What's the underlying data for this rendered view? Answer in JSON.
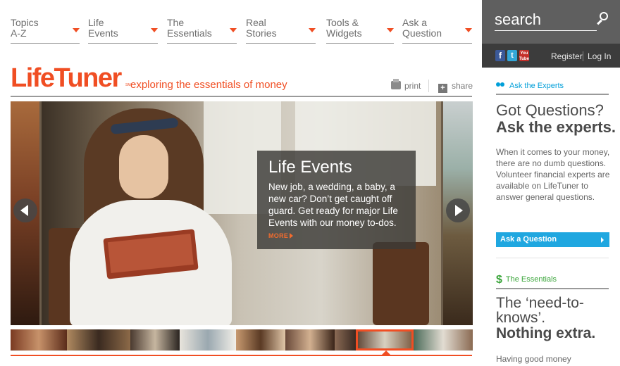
{
  "nav": {
    "items": [
      {
        "line1": "Topics",
        "line2": "A-Z"
      },
      {
        "line1": "Life",
        "line2": "Events"
      },
      {
        "line1": "The",
        "line2": "Essentials"
      },
      {
        "line1": "Real",
        "line2": "Stories"
      },
      {
        "line1": "Tools &",
        "line2": "Widgets"
      },
      {
        "line1": "Ask a",
        "line2": "Question"
      }
    ]
  },
  "brand": {
    "logo": "LifeTuner",
    "logo_mark": "SM",
    "tagline": "exploring the essentials of money",
    "accent_color": "#f04e23"
  },
  "page_actions": {
    "print": "print",
    "share": "share"
  },
  "hero": {
    "title": "Life Events",
    "body": "New job, a wedding, a baby, a new car? Don’t get caught off guard. Get ready for major Life Events with our money to-dos.",
    "more": "MORE"
  },
  "thumbnails": {
    "count": 9,
    "active_index": 7
  },
  "sidebar": {
    "search": {
      "placeholder": "search"
    },
    "social": {
      "facebook": "f",
      "twitter": "t",
      "youtube": "You Tube"
    },
    "register": "Register",
    "login": "Log In",
    "experts": {
      "header": "Ask the Experts",
      "title_line1": "Got Questions?",
      "title_line2": "Ask the experts.",
      "body": "When it comes to your money, there are no dumb questions. Volunteer financial experts are available on LifeTuner to answer general questions.",
      "button": "Ask a Question",
      "header_color": "#009fd9"
    },
    "essentials": {
      "header": "The Essentials",
      "icon_glyph": "$",
      "title_line1": "The ‘need-to-",
      "title_line2": "knows’.",
      "title_line3": "Nothing extra.",
      "body": "Having good money",
      "header_color": "#3aa53a"
    }
  }
}
